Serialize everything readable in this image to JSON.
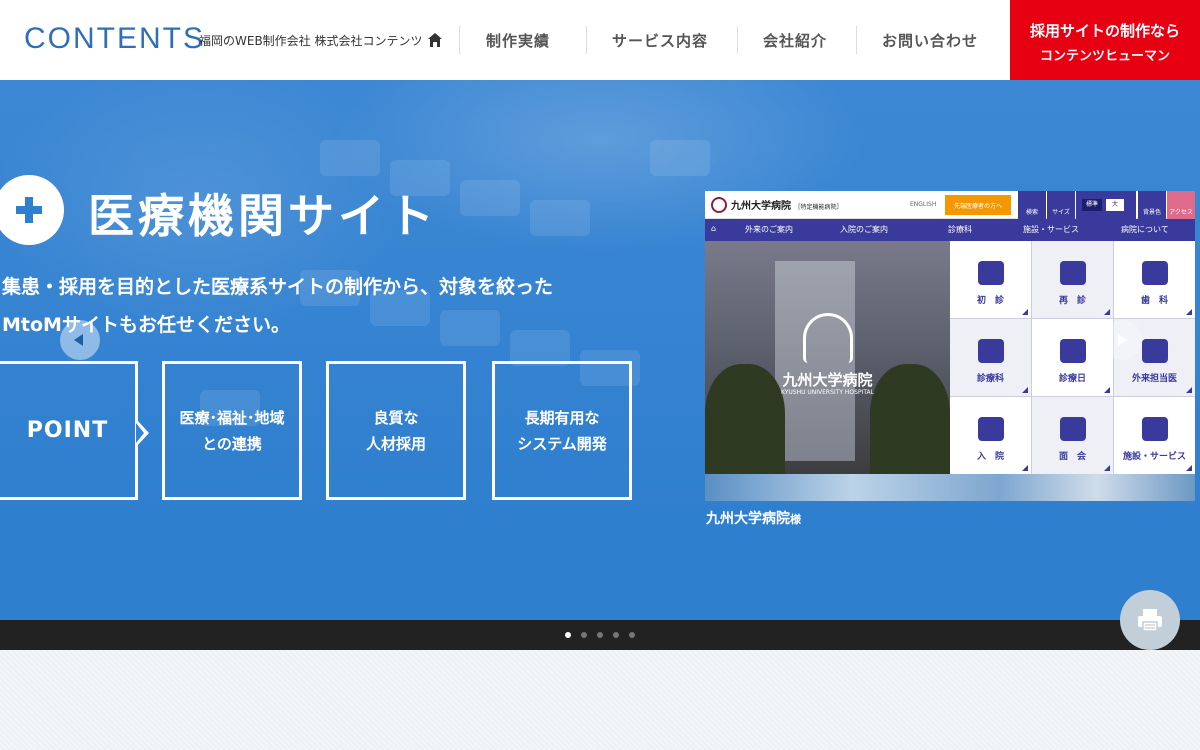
{
  "header": {
    "logo": "CONTENTS",
    "tagline": "福岡のWEB制作会社 株式会社コンテンツ",
    "nav": [
      "制作実績",
      "サービス内容",
      "会社紹介",
      "お問い合わせ"
    ],
    "recruit_cta": {
      "line1": "採用サイトの制作なら",
      "line2": "コンテンツヒューマン",
      "color": "#e60012"
    }
  },
  "hero": {
    "title": "医療機関サイト",
    "description_line1": "集患・採用を目的とした医療系サイトの制作から、対象を絞った",
    "description_line2": "MtoMサイトもお任せください。",
    "point_label": "POINT",
    "points": [
      {
        "line1": "医療･福祉･地域",
        "line2": "との連携"
      },
      {
        "line1": "良質な",
        "line2": "人材採用"
      },
      {
        "line1": "長期有用な",
        "line2": "システム開発"
      }
    ],
    "accent_color": "#2f7fcf"
  },
  "case_study": {
    "hospital_name": "九州大学病院",
    "hospital_badge": "［特定機能病院］",
    "english_link": "ENGLISH",
    "orange_button": "先端医療者の方へ",
    "tools": [
      "検索",
      "サイズ",
      "背景色",
      "アクセス"
    ],
    "font_size_options": [
      "標準",
      "大"
    ],
    "nav": [
      "外来のご案内",
      "入院のご案内",
      "診療科",
      "施設・サービス",
      "病院について"
    ],
    "photo_title": "九州大学病院",
    "photo_subtitle": "KYUSHU UNIVERSITY HOSPITAL",
    "grid": [
      "初　診",
      "再　診",
      "歯　科",
      "診療科",
      "診療日",
      "外来担当医",
      "入　院",
      "面　会",
      "施設・サービス"
    ],
    "caption": "九州大学病院",
    "caption_suffix": "様"
  },
  "slider": {
    "dot_count": 5,
    "active_index": 0
  }
}
